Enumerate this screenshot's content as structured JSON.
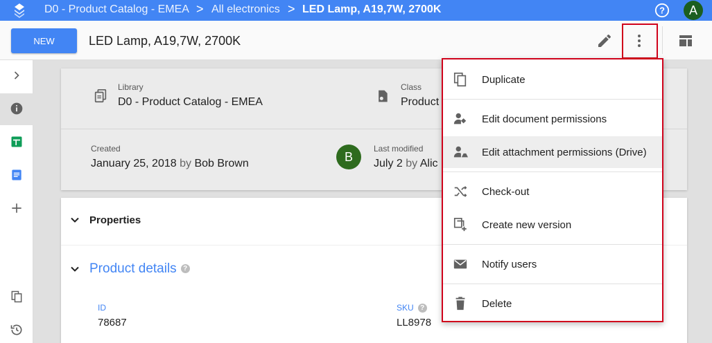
{
  "breadcrumb": {
    "items": [
      "D0 - Product Catalog - EMEA",
      "All electronics",
      "LED Lamp, A19,7W, 2700K"
    ],
    "separator": ">"
  },
  "user": {
    "initial": "A"
  },
  "toolbar": {
    "new_label": "NEW",
    "title": "LED Lamp, A19,7W, 2700K"
  },
  "info": {
    "library_label": "Library",
    "library_value": "D0 - Product Catalog - EMEA",
    "class_label": "Class",
    "class_value": "Product",
    "created_label": "Created",
    "created_date": "January 25, 2018",
    "created_by_word": "by",
    "created_by": "Bob Brown",
    "modifier_initial": "B",
    "modified_label": "Last modified",
    "modified_date": "July 2",
    "modified_by_word": "by",
    "modified_by": "Alic"
  },
  "properties": {
    "title": "Properties",
    "section_title": "Product details",
    "fields": [
      {
        "label": "ID",
        "value": "78687"
      },
      {
        "label": "SKU",
        "value": "LL8978"
      }
    ]
  },
  "menu": {
    "items": [
      {
        "label": "Duplicate",
        "icon": "duplicate-icon"
      },
      {
        "label": "Edit document permissions",
        "icon": "person-key-icon"
      },
      {
        "label": "Edit attachment permissions (Drive)",
        "icon": "person-drive-icon"
      },
      {
        "label": "Check-out",
        "icon": "checkout-icon"
      },
      {
        "label": "Create new version",
        "icon": "new-version-icon"
      },
      {
        "label": "Notify users",
        "icon": "mail-icon"
      },
      {
        "label": "Delete",
        "icon": "trash-icon"
      }
    ]
  },
  "colors": {
    "brand": "#4285f4",
    "highlight": "#d0021b",
    "avatar": "#2e6b1e"
  }
}
